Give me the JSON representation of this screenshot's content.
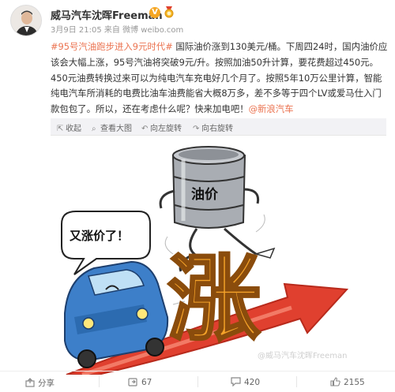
{
  "post": {
    "username": "威马汽车沈晖Freeman",
    "verified_badge": "V",
    "timestamp": "3月9日 21:05",
    "source": "来自 微博 weibo.com",
    "hashtag": "#95号汽油跑步进入9元时代#",
    "body_text": " 国际油价涨到130美元/桶。下周四24时，国内油价应该会大幅上涨，95号汽油将突破9元/升。按照加油50升计算，要花费超过450元。450元油费转换过来可以为纯电汽车充电好几个月了。按照5年10万公里计算，智能纯电汽车所消耗的电费比油车油费能省大概8万多，差不多等于四个LV或爱马仕入门款包包了。所以，还在考虑什么呢？快来加电吧！",
    "mention": "@新浪汽车"
  },
  "image_toolbar": {
    "collapse_label": "收起",
    "view_large_label": "查看大图",
    "rotate_left_label": "向左旋转",
    "rotate_right_label": "向右旋转"
  },
  "illustration": {
    "barrel_label": "油价",
    "speech_bubble": "又涨价了！",
    "rise_character": "涨",
    "watermark": "@威马汽车沈晖Freeman"
  },
  "actions": {
    "share_label": "分享",
    "repost_count": "67",
    "comment_count": "420",
    "like_count": "2155"
  },
  "icons": {
    "avatar": "person-avatar",
    "medal": "medal-icon",
    "collapse": "collapse-arrow-icon",
    "view_large": "magnifier-icon",
    "rotate_left": "rotate-left-icon",
    "rotate_right": "rotate-right-icon",
    "share": "share-icon",
    "repost": "repost-icon",
    "comment": "comment-icon",
    "like": "thumbs-up-icon"
  },
  "colors": {
    "link": "#eb7350",
    "badge": "#f5a623",
    "arrow_red": "#e0402f",
    "car_blue": "#3d7fc9"
  }
}
